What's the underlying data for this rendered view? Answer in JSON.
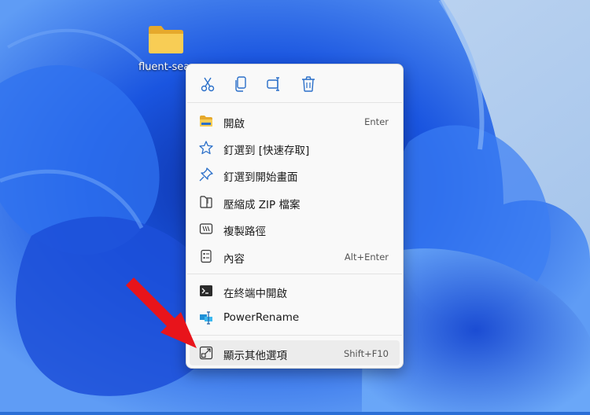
{
  "desktop": {
    "icon_label": "fluent-sea"
  },
  "context_menu": {
    "quick_actions": [
      {
        "name": "cut",
        "icon": "scissors-icon"
      },
      {
        "name": "copy",
        "icon": "copy-icon"
      },
      {
        "name": "rename",
        "icon": "rename-icon"
      },
      {
        "name": "delete",
        "icon": "trash-icon"
      }
    ],
    "items": [
      {
        "label": "開啟",
        "shortcut": "Enter",
        "icon": "folder-icon"
      },
      {
        "label": "釘選到 [快速存取]",
        "shortcut": "",
        "icon": "star-icon"
      },
      {
        "label": "釘選到開始畫面",
        "shortcut": "",
        "icon": "pin-icon"
      },
      {
        "label": "壓縮成 ZIP 檔案",
        "shortcut": "",
        "icon": "zip-icon"
      },
      {
        "label": "複製路徑",
        "shortcut": "",
        "icon": "copy-path-icon"
      },
      {
        "label": "內容",
        "shortcut": "Alt+Enter",
        "icon": "properties-icon"
      },
      {
        "label": "在終端中開啟",
        "shortcut": "",
        "icon": "terminal-icon"
      },
      {
        "label": "PowerRename",
        "shortcut": "",
        "icon": "powerrename-icon"
      },
      {
        "label": "顯示其他選項",
        "shortcut": "Shift+F10",
        "icon": "more-options-icon"
      }
    ]
  },
  "colors": {
    "accent": "#2b6fd6",
    "arrow": "#e8141b",
    "menu_bg": "#f9f9f9"
  }
}
